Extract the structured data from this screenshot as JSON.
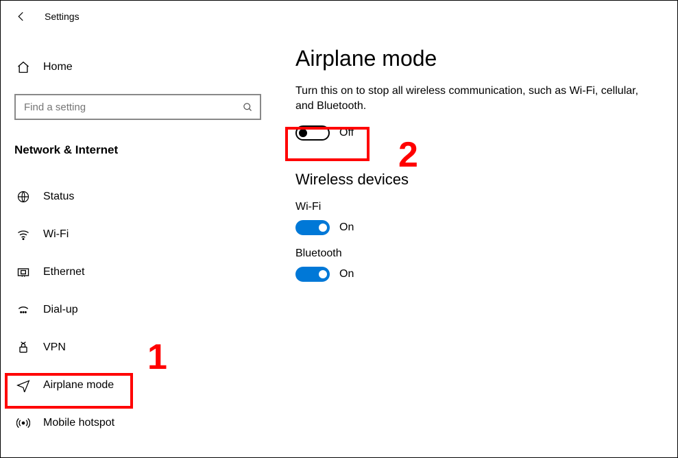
{
  "header": {
    "app_title": "Settings"
  },
  "sidebar": {
    "home_label": "Home",
    "search_placeholder": "Find a setting",
    "category": "Network & Internet",
    "items": [
      {
        "label": "Status"
      },
      {
        "label": "Wi-Fi"
      },
      {
        "label": "Ethernet"
      },
      {
        "label": "Dial-up"
      },
      {
        "label": "VPN"
      },
      {
        "label": "Airplane mode"
      },
      {
        "label": "Mobile hotspot"
      }
    ]
  },
  "main": {
    "title": "Airplane mode",
    "description": "Turn this on to stop all wireless communication, such as Wi-Fi, cellular, and Bluetooth.",
    "airplane_toggle_label": "Off",
    "wireless_section": "Wireless devices",
    "wifi": {
      "name": "Wi-Fi",
      "state_label": "On"
    },
    "bluetooth": {
      "name": "Bluetooth",
      "state_label": "On"
    }
  },
  "annotations": {
    "label1": "1",
    "label2": "2"
  }
}
